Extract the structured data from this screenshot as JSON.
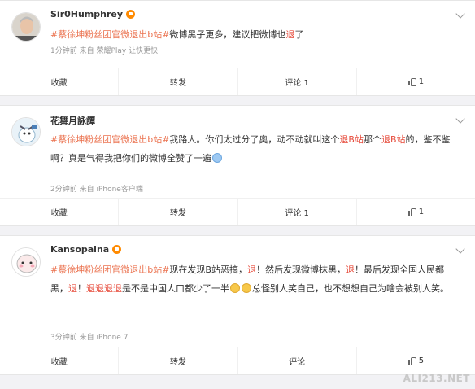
{
  "posts": [
    {
      "author": "Sir0Humphrey",
      "topic": "#蔡徐坤粉丝团官微退出b站#",
      "text": "微博黑子更多，建议把微博也",
      "text_red_end": "退",
      "text_end": "了",
      "meta": "1分钟前 来自 荣耀Play 让快更快",
      "actions": {
        "favorite": "收藏",
        "repost": "转发",
        "comment": "评论 1",
        "like": "1"
      }
    },
    {
      "author": "花舞月詠譚",
      "topic": "#蔡徐坤粉丝团官微退出b站#",
      "text_a": "我路人。你们太过分了奥，动不动就叫这个",
      "red_a": "退B站",
      "text_b": "那个",
      "red_b": "退B站",
      "text_c": "的，鉴不鉴啊？真是气得我把你们的微博全赞了一遍",
      "meta": "2分钟前 来自 iPhone客户端",
      "actions": {
        "favorite": "收藏",
        "repost": "转发",
        "comment": "评论 1",
        "like": "1"
      }
    },
    {
      "author": "Kansopalna",
      "topic": "#蔡徐坤粉丝团官微退出b站#",
      "text_a": "现在发现B站恶搞，",
      "red_a": "退",
      "text_b": "！然后发现微博抹黑，",
      "red_b": "退",
      "text_c": "！最后发现全国人民都黑，",
      "red_c": "退",
      "text_d": "！",
      "red_d": "退退退退",
      "text_e": "是不是中国人口都少了一半",
      "text_f": "总怪别人笑自己，也不想想自己为啥会被别人笑。",
      "meta": "3分钟前 来自 iPhone 7",
      "actions": {
        "favorite": "收藏",
        "repost": "转发",
        "comment": "评论",
        "like": "5"
      }
    }
  ],
  "watermark": "ALI213.NET",
  "colors": {
    "topic": "#eb7350",
    "red": "#e74c3c",
    "background": "#f2f2f5"
  }
}
